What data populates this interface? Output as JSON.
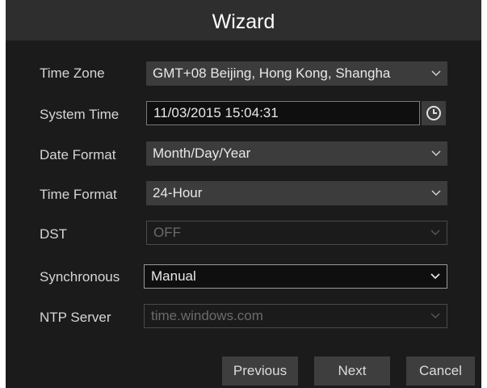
{
  "dialog": {
    "title": "Wizard"
  },
  "fields": {
    "time_zone": {
      "label": "Time Zone",
      "value": "GMT+08 Beijing, Hong Kong, Shangha"
    },
    "system_time": {
      "label": "System Time",
      "value": "11/03/2015 15:04:31"
    },
    "date_format": {
      "label": "Date Format",
      "value": "Month/Day/Year"
    },
    "time_format": {
      "label": "Time Format",
      "value": "24-Hour"
    },
    "dst": {
      "label": "DST",
      "value": "OFF"
    },
    "synchronous": {
      "label": "Synchronous",
      "value": "Manual"
    },
    "ntp_server": {
      "label": "NTP Server",
      "value": "time.windows.com"
    }
  },
  "buttons": {
    "previous": "Previous",
    "next": "Next",
    "cancel": "Cancel"
  },
  "icons": {
    "clock": "clock-icon",
    "dropdown": "chevron-down-icon"
  },
  "colors": {
    "background": "#1b1b1b",
    "title_bar": "#2e2e2e",
    "field": "#3c3c3c",
    "button": "#3e3e3e"
  }
}
